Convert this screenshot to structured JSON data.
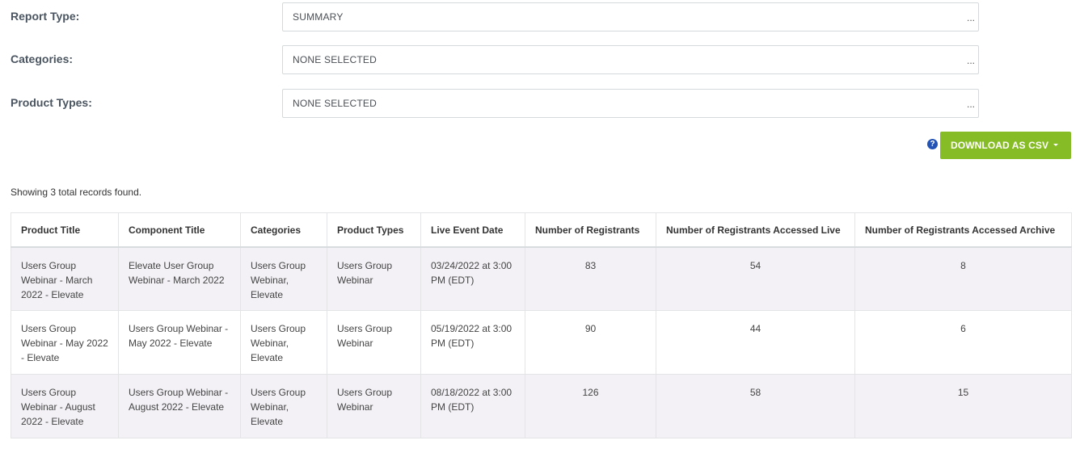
{
  "filters": [
    {
      "label": "Report Type:",
      "value": "SUMMARY",
      "more": "..."
    },
    {
      "label": "Categories:",
      "value": "NONE SELECTED",
      "more": "..."
    },
    {
      "label": "Product Types:",
      "value": "NONE SELECTED",
      "more": "..."
    }
  ],
  "toolbar": {
    "help_glyph": "?",
    "download_label": "DOWNLOAD AS CSV"
  },
  "summary": {
    "records_text": "Showing 3 total records found."
  },
  "table": {
    "headers": [
      "Product Title",
      "Component Title",
      "Categories",
      "Product Types",
      "Live Event Date",
      "Number of Registrants",
      "Number of Registrants Accessed Live",
      "Number of Registrants Accessed Archive"
    ],
    "rows": [
      {
        "product_title": "Users Group Webinar - March 2022 - Elevate",
        "component_title": "Elevate User Group Webinar - March 2022",
        "categories": "Users Group Webinar, Elevate",
        "product_types": "Users Group Webinar",
        "live_event_date": "03/24/2022 at 3:00 PM (EDT)",
        "registrants": "83",
        "accessed_live": "54",
        "accessed_archive": "8"
      },
      {
        "product_title": "Users Group Webinar - May 2022 - Elevate",
        "component_title": "Users Group Webinar - May 2022 - Elevate",
        "categories": "Users Group Webinar, Elevate",
        "product_types": "Users Group Webinar",
        "live_event_date": "05/19/2022 at 3:00 PM (EDT)",
        "registrants": "90",
        "accessed_live": "44",
        "accessed_archive": "6"
      },
      {
        "product_title": "Users Group Webinar - August 2022 - Elevate",
        "component_title": "Users Group Webinar - August 2022 - Elevate",
        "categories": "Users Group Webinar, Elevate",
        "product_types": "Users Group Webinar",
        "live_event_date": "08/18/2022 at 3:00 PM (EDT)",
        "registrants": "126",
        "accessed_live": "58",
        "accessed_archive": "15"
      }
    ]
  },
  "colors": {
    "download_button": "#86bc25",
    "help_icon": "#2354b5",
    "row_stripe": "#f3f1f5"
  },
  "icons": {
    "help": "question-circle-icon",
    "dropdown": "caret-down-icon",
    "more": "ellipsis-icon"
  }
}
